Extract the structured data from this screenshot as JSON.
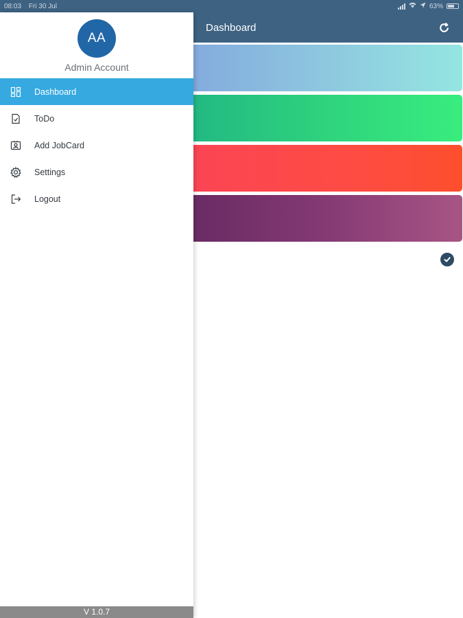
{
  "status_bar": {
    "time": "08:03",
    "date": "Fri 30 Jul",
    "battery": "63%",
    "battery_level": 0.63,
    "icons": [
      "signal-icon",
      "wifi-icon",
      "location-icon",
      "battery-icon"
    ]
  },
  "drawer": {
    "avatar_initials": "AA",
    "account_name": "Admin Account",
    "items": [
      {
        "label": "Dashboard",
        "icon": "dashboard-icon",
        "active": true
      },
      {
        "label": "ToDo",
        "icon": "todo-icon",
        "active": false
      },
      {
        "label": "Add JobCard",
        "icon": "jobcard-icon",
        "active": false
      },
      {
        "label": "Settings",
        "icon": "gear-icon",
        "active": false
      },
      {
        "label": "Logout",
        "icon": "logout-icon",
        "active": false
      }
    ],
    "version": "V 1.0.7"
  },
  "header": {
    "title": "Dashboard",
    "refresh_icon": "refresh-icon"
  },
  "cards": [
    {
      "name": "card-blue",
      "colors": [
        "#84abde",
        "#94e6e1"
      ]
    },
    {
      "name": "card-green",
      "colors": [
        "#22b983",
        "#38ed7e"
      ]
    },
    {
      "name": "card-red",
      "colors": [
        "#fb4554",
        "#fe4e2d"
      ]
    },
    {
      "name": "card-purple",
      "colors": [
        "#6a2b64",
        "#a85585"
      ]
    }
  ],
  "check_icon": "check-circle-icon",
  "colors": {
    "header": "#3e6282",
    "accent": "#36a9e1",
    "avatar": "#2166a6",
    "version_bar": "#8a8a8a"
  }
}
